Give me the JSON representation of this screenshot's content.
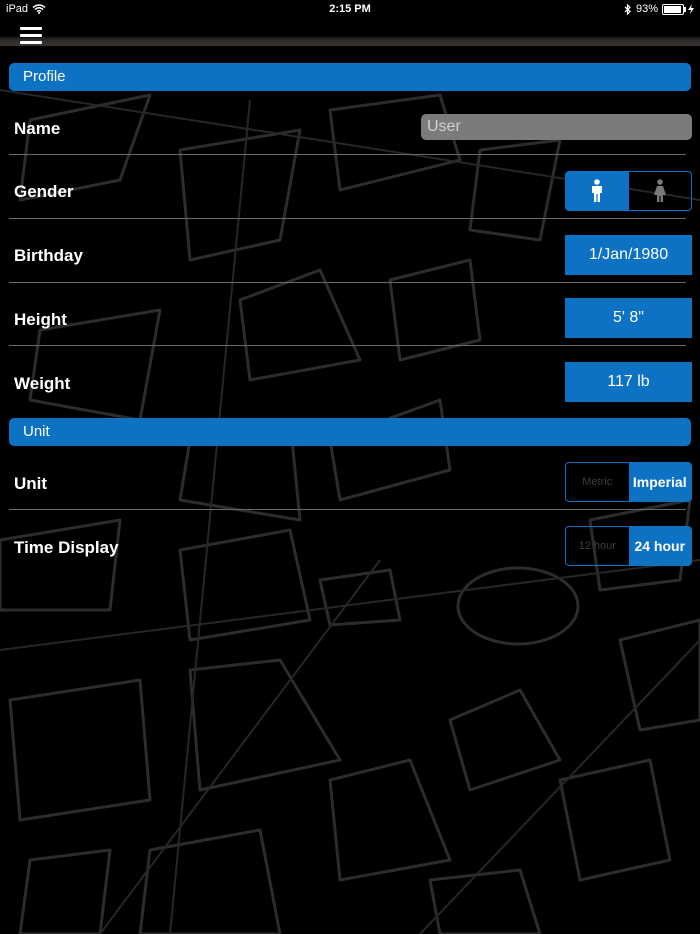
{
  "status_bar": {
    "device": "iPad",
    "time": "2:15 PM",
    "battery": "93%",
    "battery_level": 0.93,
    "wifi_icon": "wifi-icon",
    "bluetooth_icon": "bluetooth-icon"
  },
  "nav": {
    "menu_icon": "hamburger-icon"
  },
  "colors": {
    "accent": "#0d71c4",
    "separator": "#6a6a6a",
    "input_bg": "#7b7b7b"
  },
  "profile": {
    "header": "Profile",
    "name_label": "Name",
    "name_placeholder": "User",
    "gender_label": "Gender",
    "gender_options": [
      "male-icon",
      "female-icon"
    ],
    "gender_selected": "male",
    "birthday_label": "Birthday",
    "birthday_value": "1/Jan/1980",
    "height_label": "Height",
    "height_value": "5' 8\"",
    "weight_label": "Weight",
    "weight_value": "117 lb"
  },
  "unit_section": {
    "header": "Unit",
    "unit_label": "Unit",
    "unit_options": [
      "Metric",
      "Imperial"
    ],
    "unit_selected": "Imperial",
    "time_label": "Time Display",
    "time_options": [
      "12 hour",
      "24 hour"
    ],
    "time_selected": "24 hour"
  }
}
